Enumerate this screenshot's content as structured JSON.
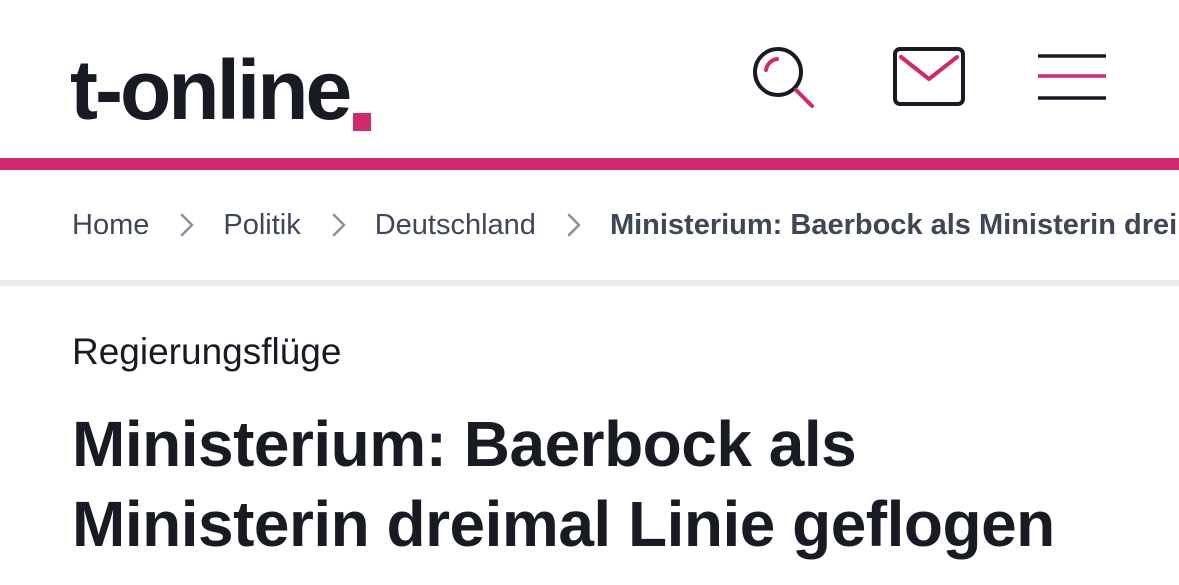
{
  "header": {
    "logo_text": "t-online",
    "search_label": "Suche",
    "mail_label": "E-Mail",
    "menu_label": "Menü"
  },
  "colors": {
    "brand_magenta": "#d2296e",
    "text_dark": "#191b24",
    "text_breadcrumb": "#3f4656",
    "divider_gray": "#e8eaf0"
  },
  "icons": {
    "search": "search-icon",
    "mail": "mail-icon",
    "menu": "hamburger-menu-icon",
    "separator": "chevron-right-icon"
  },
  "breadcrumb": {
    "items": [
      {
        "label": "Home"
      },
      {
        "label": "Politik"
      },
      {
        "label": "Deutschland"
      },
      {
        "label": "Ministerium: Baerbock als Ministerin dreimal Linie geflogen"
      }
    ]
  },
  "article": {
    "kicker": "Regierungsflüge",
    "title": "Ministerium: Baerbock als Ministerin dreimal Linie geflogen"
  }
}
